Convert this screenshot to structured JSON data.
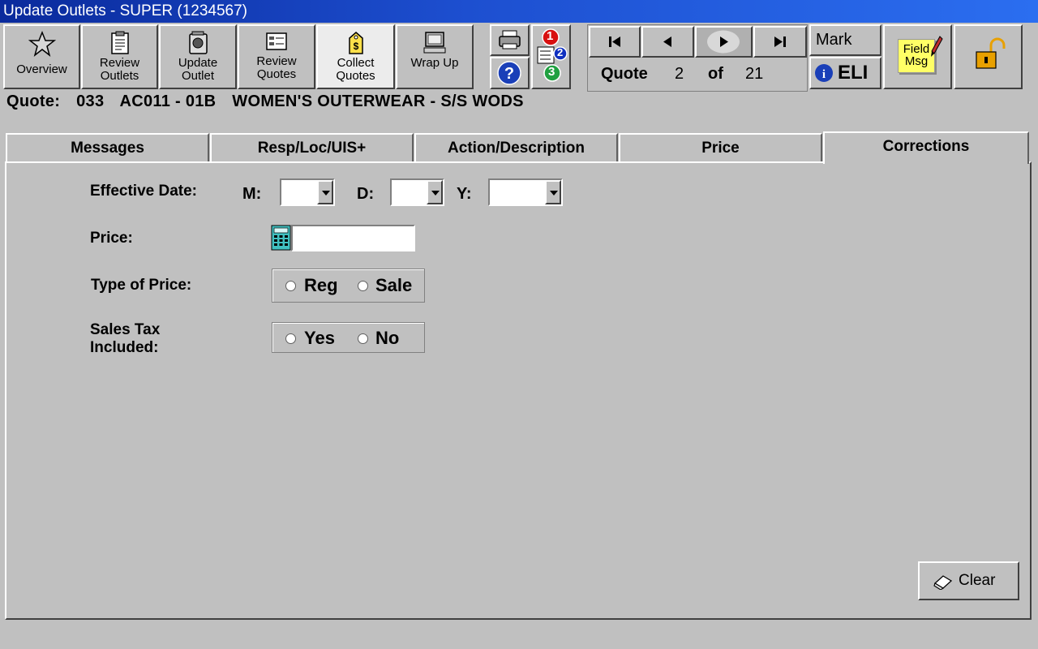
{
  "window": {
    "title": "Update Outlets -  SUPER (1234567)"
  },
  "toolbar": {
    "overview": "Overview",
    "review_outlets_line1": "Review",
    "review_outlets_line2": "Outlets",
    "update_outlet_line1": "Update",
    "update_outlet_line2": "Outlet",
    "review_quotes_line1": "Review",
    "review_quotes_line2": "Quotes",
    "collect_quotes_line1": "Collect",
    "collect_quotes_line2": "Quotes",
    "wrap_up": "Wrap Up",
    "badge_1": "1",
    "badge_2": "2",
    "badge_3": "3",
    "mark": "Mark",
    "eli": "ELI",
    "field_msg_line1": "Field",
    "field_msg_line2": "Msg"
  },
  "nav": {
    "label": "Quote",
    "current": "2",
    "of": "of",
    "total": "21"
  },
  "quote": {
    "label": "Quote:",
    "number": "033",
    "code": "AC011 - 01B",
    "description": "WOMEN'S OUTERWEAR - S/S WODS"
  },
  "tabs": [
    "Messages",
    "Resp/Loc/UIS+",
    "Action/Description",
    "Price",
    "Corrections"
  ],
  "active_tab": "Corrections",
  "form": {
    "effective_date_label": "Effective Date:",
    "month_label": "M:",
    "day_label": "D:",
    "year_label": "Y:",
    "month_value": "",
    "day_value": "",
    "year_value": "",
    "price_label": "Price:",
    "price_value": "",
    "type_of_price_label": "Type of Price:",
    "reg_label": "Reg",
    "sale_label": "Sale",
    "sales_tax_label_line1": "Sales Tax",
    "sales_tax_label_line2": "Included:",
    "yes_label": "Yes",
    "no_label": "No"
  },
  "clear_button": "Clear",
  "icons": {
    "overview": "star-icon",
    "review_outlets": "clipboard-icon",
    "update_outlet": "binder-icon",
    "review_quotes": "document-list-icon",
    "collect_quotes": "price-tag-icon",
    "wrap_up": "computer-icon",
    "print": "printer-icon",
    "help": "help-icon",
    "priority": "numbered-priority-icon",
    "first": "first-record-icon",
    "prev": "previous-record-icon",
    "next": "next-record-icon",
    "last": "last-record-icon",
    "info": "info-icon",
    "field_msg": "note-pencil-icon",
    "lock": "unlock-icon",
    "calculator": "calculator-icon",
    "clear": "eraser-icon"
  },
  "colors": {
    "titlebar_start": "#0a2a9c",
    "titlebar_end": "#2b6ef0",
    "window_bg": "#c0c0c0",
    "sticky_note": "#ffff66",
    "badge_red": "#d81010",
    "badge_blue": "#1030c0",
    "badge_green": "#20a040",
    "help_blue": "#1a3fb8",
    "lock_gold": "#e8a000",
    "calculator_teal": "#40c0c0"
  }
}
